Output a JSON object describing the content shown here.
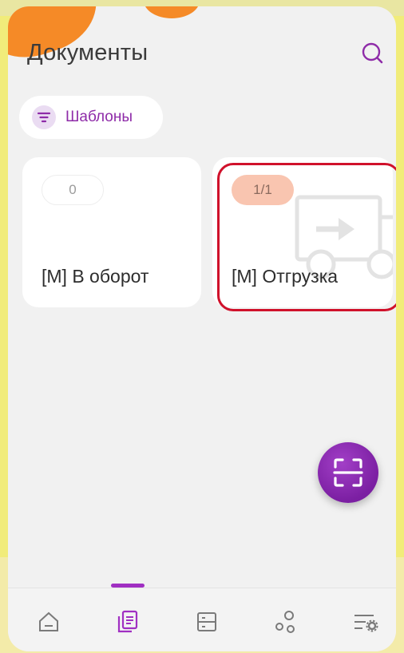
{
  "header": {
    "title": "Документы",
    "search_icon": "search-icon"
  },
  "filter_chip": {
    "label": "Шаблоны",
    "icon": "filter-icon"
  },
  "cards": [
    {
      "badge": "0",
      "label": "[M] В оборот"
    },
    {
      "badge": "1/1",
      "label": "[M] Отгрузка",
      "icon": "truck-arrow-icon"
    }
  ],
  "fab": {
    "icon": "scan-icon"
  },
  "bottom_nav": {
    "items": [
      {
        "icon": "home-icon",
        "active": false
      },
      {
        "icon": "documents-icon",
        "active": true
      },
      {
        "icon": "storage-icon",
        "active": false
      },
      {
        "icon": "nodes-icon",
        "active": false
      },
      {
        "icon": "settings-list-icon",
        "active": false
      }
    ]
  },
  "colors": {
    "accent": "#8e2ba8",
    "highlight_border": "#d0112b",
    "badge_active": "#f9c5b0",
    "background": "#f1f1f1"
  }
}
